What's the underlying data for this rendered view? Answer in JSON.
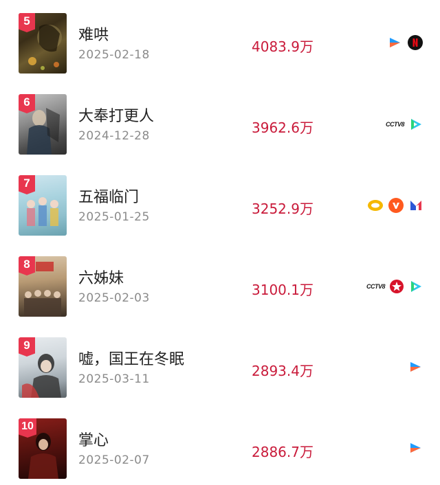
{
  "colors": {
    "rank_badge": "#e8364e",
    "view_count": "#c91a3a",
    "date": "#8b8b8b",
    "tencent_blue": "#2ec7f0",
    "tencent_green": "#2bd47a",
    "tencent_orange": "#ff8a1f",
    "youku_blue": "#1f9cff",
    "youku_orange": "#ff6a3d",
    "netflix_red": "#e50914",
    "mango_orange": "#ff5a1f",
    "mgtv_blue": "#2b57d6",
    "mgtv_red": "#e8364e",
    "cctv_red": "#d7132a"
  },
  "rows": [
    {
      "rank": "5",
      "title": "难哄",
      "date": "2025-02-18",
      "views": "4083.9万",
      "platforms": [
        "youku-icon",
        "netflix-icon"
      ]
    },
    {
      "rank": "6",
      "title": "大奉打更人",
      "date": "2024-12-28",
      "views": "3962.6万",
      "platforms": [
        "cctv-icon",
        "tencent-video-icon"
      ],
      "cctv_text": "CCTV8"
    },
    {
      "rank": "7",
      "title": "五福临门",
      "date": "2025-01-25",
      "views": "3252.9万",
      "platforms": [
        "hunan-tv-icon",
        "mango-tv-icon",
        "mgtv-icon"
      ]
    },
    {
      "rank": "8",
      "title": "六姊妹",
      "date": "2025-02-03",
      "views": "3100.1万",
      "platforms": [
        "cctv-icon",
        "dragon-tv-icon",
        "tencent-video-icon"
      ],
      "cctv_text": "CCTV8"
    },
    {
      "rank": "9",
      "title": "嘘，国王在冬眠",
      "date": "2025-03-11",
      "views": "2893.4万",
      "platforms": [
        "youku-icon"
      ]
    },
    {
      "rank": "10",
      "title": "掌心",
      "date": "2025-02-07",
      "views": "2886.7万",
      "platforms": [
        "youku-icon"
      ]
    }
  ]
}
